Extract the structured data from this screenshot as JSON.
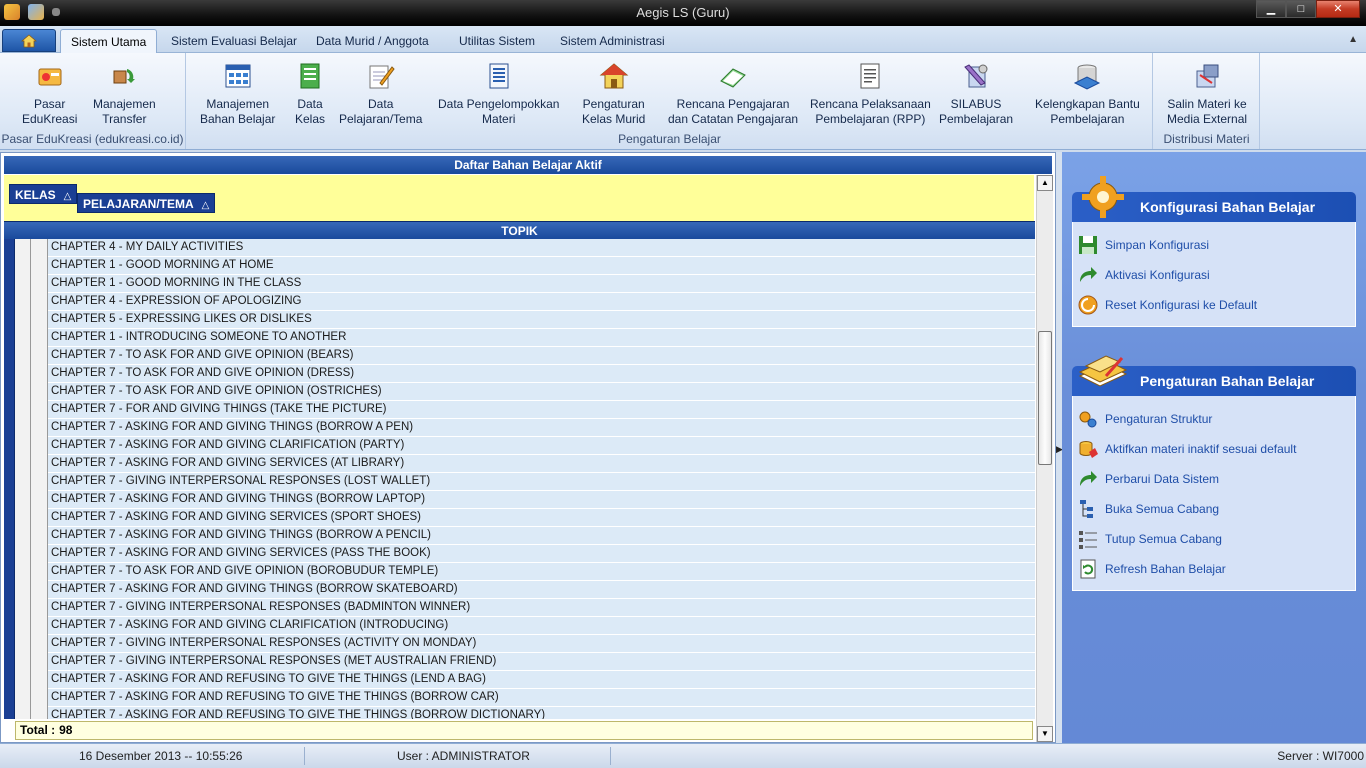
{
  "window": {
    "title": "Aegis LS (Guru)",
    "min_label": "▁",
    "max_label": "□",
    "close_label": "✕"
  },
  "tabs": [
    {
      "label": "Sistem Utama",
      "active": true
    },
    {
      "label": "Sistem Evaluasi Belajar"
    },
    {
      "label": "Data Murid / Anggota"
    },
    {
      "label": "Utilitas Sistem"
    },
    {
      "label": "Sistem Administrasi"
    }
  ],
  "ribbon": {
    "groups": [
      {
        "label": "Pasar EduKreasi (edukreasi.co.id)"
      },
      {
        "label": "Pengaturan Belajar"
      },
      {
        "label": "Distribusi Materi"
      }
    ],
    "buttons": [
      {
        "label1": "Pasar",
        "label2": "EduKreasi",
        "icon": "market-icon"
      },
      {
        "label1": "Manajemen",
        "label2": "Transfer",
        "icon": "transfer-icon"
      },
      {
        "label1": "Manajemen",
        "label2": "Bahan Belajar",
        "icon": "grid-icon"
      },
      {
        "label1": "Data",
        "label2": "Kelas",
        "icon": "class-icon"
      },
      {
        "label1": "Data",
        "label2": "Pelajaran/Tema",
        "icon": "pencil-icon"
      },
      {
        "label1": "Data Pengelompokkan",
        "label2": "Materi",
        "icon": "list-doc-icon"
      },
      {
        "label1": "Pengaturan",
        "label2": "Kelas Murid",
        "icon": "house-icon"
      },
      {
        "label1": "Rencana Pengajaran",
        "label2": "dan Catatan Pengajaran",
        "icon": "book-icon"
      },
      {
        "label1": "Rencana Pelaksanaan",
        "label2": "Pembelajaran (RPP)",
        "icon": "document-icon"
      },
      {
        "label1": "SILABUS",
        "label2": "Pembelajaran",
        "icon": "tools-icon"
      },
      {
        "label1": "Kelengkapan Bantu",
        "label2": "Pembelajaran",
        "icon": "database-icon"
      },
      {
        "label1": "Salin Materi ke",
        "label2": "Media External",
        "icon": "copy-media-icon"
      }
    ]
  },
  "grid": {
    "title": "Daftar Bahan Belajar Aktif",
    "group_chips": [
      "KELAS",
      "PELAJARAN/TEMA"
    ],
    "sort_glyph": "△",
    "column_header": "TOPIK",
    "rows": [
      "CHAPTER 4 - MY DAILY ACTIVITIES",
      "CHAPTER 1 - GOOD MORNING AT HOME",
      "CHAPTER 1 - GOOD MORNING IN THE CLASS",
      "CHAPTER 4 - EXPRESSION OF APOLOGIZING",
      "CHAPTER 5 - EXPRESSING LIKES OR DISLIKES",
      "CHAPTER 1 - INTRODUCING SOMEONE TO ANOTHER",
      "CHAPTER 7 - TO ASK FOR AND GIVE OPINION (BEARS)",
      "CHAPTER 7 - TO ASK FOR AND GIVE OPINION (DRESS)",
      "CHAPTER 7 - TO ASK FOR AND GIVE OPINION (OSTRICHES)",
      "CHAPTER 7 - FOR AND GIVING THINGS (TAKE THE PICTURE)",
      "CHAPTER 7 - ASKING FOR AND GIVING THINGS (BORROW A PEN)",
      "CHAPTER 7 - ASKING FOR AND GIVING CLARIFICATION (PARTY)",
      "CHAPTER 7 - ASKING FOR AND GIVING SERVICES (AT LIBRARY)",
      "CHAPTER 7 - GIVING INTERPERSONAL RESPONSES (LOST WALLET)",
      "CHAPTER 7 - ASKING FOR AND GIVING THINGS (BORROW LAPTOP)",
      "CHAPTER 7 - ASKING FOR AND GIVING SERVICES (SPORT SHOES)",
      "CHAPTER 7 - ASKING FOR AND GIVING THINGS (BORROW A PENCIL)",
      "CHAPTER 7 - ASKING FOR AND GIVING SERVICES (PASS THE BOOK)",
      "CHAPTER 7 -  TO ASK FOR AND GIVE OPINION (BOROBUDUR TEMPLE)",
      "CHAPTER 7 - ASKING FOR AND GIVING THINGS (BORROW SKATEBOARD)",
      "CHAPTER 7 - GIVING INTERPERSONAL RESPONSES (BADMINTON WINNER)",
      "CHAPTER 7 - ASKING FOR AND GIVING CLARIFICATION (INTRODUCING)",
      "CHAPTER 7 - GIVING INTERPERSONAL RESPONSES (ACTIVITY ON MONDAY)",
      "CHAPTER 7 - GIVING INTERPERSONAL RESPONSES (MET AUSTRALIAN FRIEND)",
      "CHAPTER 7 - ASKING FOR AND REFUSING TO GIVE THE THINGS (LEND A BAG)",
      "CHAPTER 7 - ASKING FOR AND REFUSING TO GIVE THE THINGS (BORROW CAR)",
      "CHAPTER 7 - ASKING FOR AND REFUSING TO GIVE THE THINGS (BORROW DICTIONARY)"
    ],
    "total_label": "Total  :",
    "total_value": "98"
  },
  "taskpane": {
    "config": {
      "title": "Konfigurasi Bahan Belajar",
      "items": [
        {
          "label": "Simpan Konfigurasi",
          "icon": "save-icon"
        },
        {
          "label": "Aktivasi Konfigurasi",
          "icon": "forward-arrow-icon"
        },
        {
          "label": "Reset Konfigurasi ke Default",
          "icon": "reset-icon"
        }
      ]
    },
    "settings": {
      "title": "Pengaturan Bahan Belajar",
      "items": [
        {
          "label": "Pengaturan Struktur",
          "icon": "gears-icon"
        },
        {
          "label": "Aktifkan materi inaktif sesuai default",
          "icon": "activate-icon"
        },
        {
          "label": "Perbarui Data Sistem",
          "icon": "update-arrow-icon"
        },
        {
          "label": "Buka Semua Cabang",
          "icon": "expand-tree-icon"
        },
        {
          "label": "Tutup Semua Cabang",
          "icon": "collapse-tree-icon"
        },
        {
          "label": "Refresh Bahan Belajar",
          "icon": "refresh-icon"
        }
      ]
    }
  },
  "status": {
    "datetime": "16 Desember 2013 -- 10:55:26",
    "user": "User : ADMINISTRATOR",
    "server": "Server : WI7000"
  },
  "colors": {
    "header_blue": "#1a4a9c",
    "group_yellow": "#ffff99",
    "row_blue": "#dceaf7",
    "pane_blue": "#6a8fd9"
  }
}
